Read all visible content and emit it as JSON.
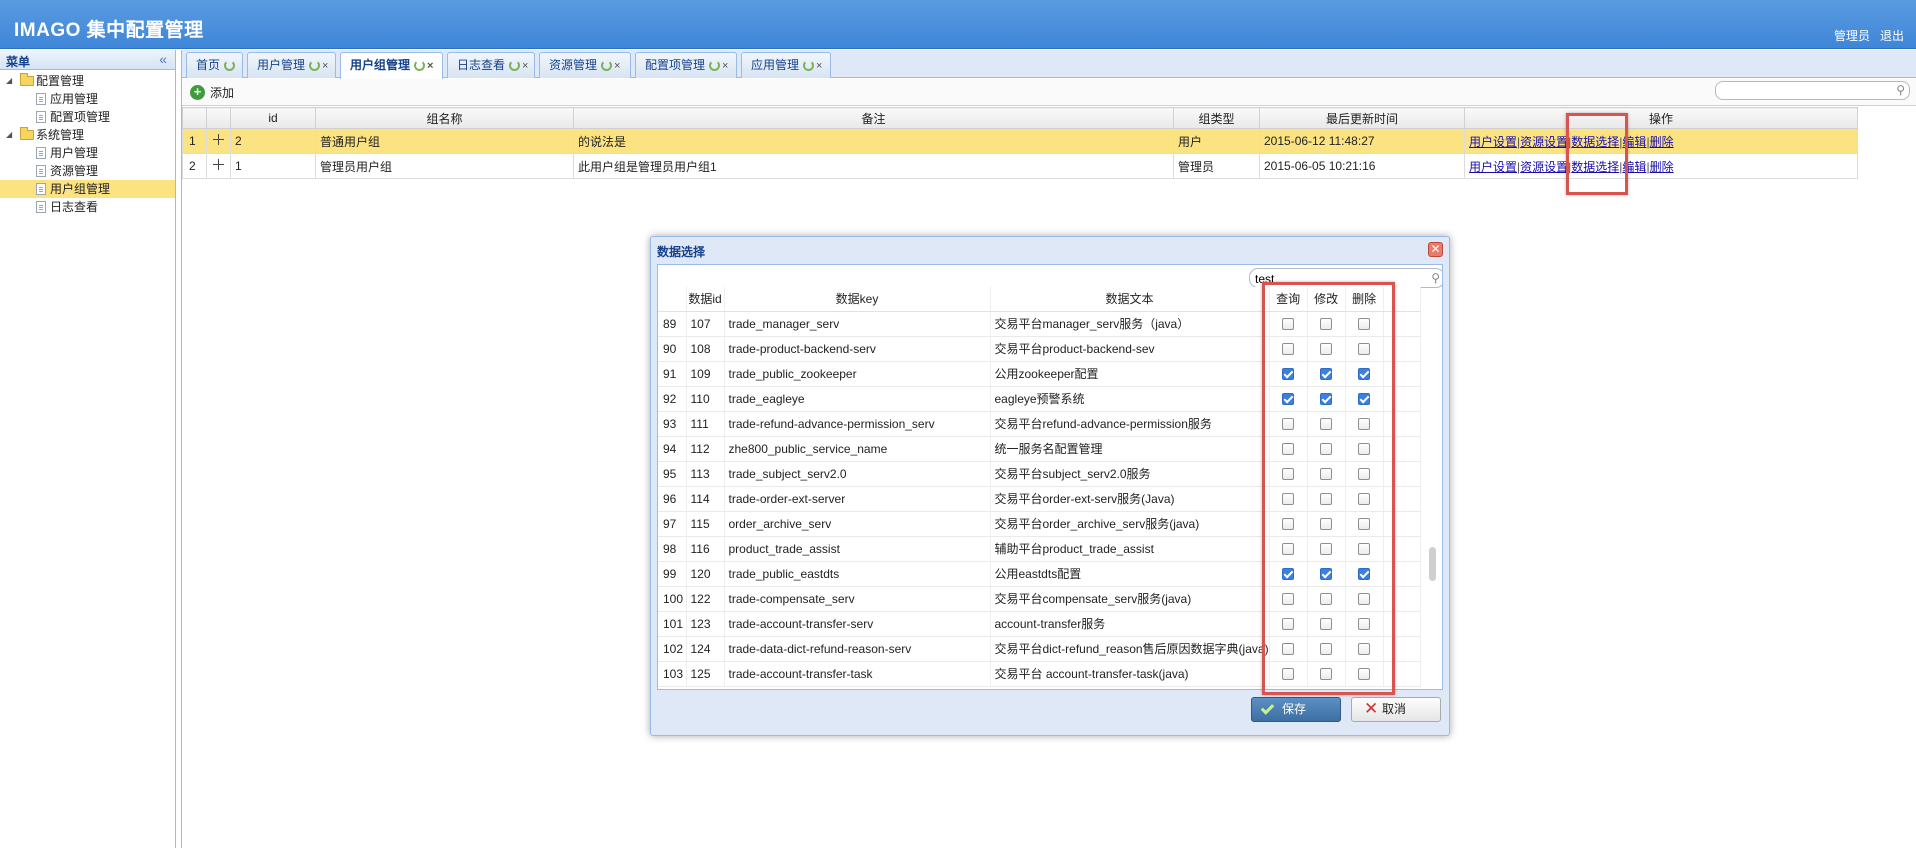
{
  "header": {
    "title": "IMAGO 集中配置管理",
    "user": "管理员",
    "logout": "退出"
  },
  "sidebar": {
    "title": "菜单",
    "collapse_glyph": "«",
    "groups": [
      {
        "label": "配置管理",
        "children": [
          "应用管理",
          "配置项管理"
        ]
      },
      {
        "label": "系统管理",
        "children": [
          "用户管理",
          "资源管理",
          "用户组管理",
          "日志查看"
        ]
      }
    ],
    "selected": "用户组管理"
  },
  "tabs": [
    {
      "label": "首页",
      "active": false,
      "closable": false
    },
    {
      "label": "用户管理",
      "active": false,
      "closable": true
    },
    {
      "label": "用户组管理",
      "active": true,
      "closable": true
    },
    {
      "label": "日志查看",
      "active": false,
      "closable": true
    },
    {
      "label": "资源管理",
      "active": false,
      "closable": true
    },
    {
      "label": "配置项管理",
      "active": false,
      "closable": true
    },
    {
      "label": "应用管理",
      "active": false,
      "closable": true
    }
  ],
  "toolbar": {
    "add_label": "添加",
    "search_placeholder": ""
  },
  "grid": {
    "columns": [
      "id",
      "组名称",
      "备注",
      "组类型",
      "最后更新时间",
      "操作"
    ],
    "rows": [
      {
        "n": "1",
        "id": "2",
        "name": "普通用户组",
        "remark": "的说法是",
        "type": "用户",
        "updated": "2015-06-12 11:48:27"
      },
      {
        "n": "2",
        "id": "1",
        "name": "管理员用户组",
        "remark": "此用户组是管理员用户组1",
        "type": "管理员",
        "updated": "2015-06-05 10:21:16"
      }
    ],
    "ops": [
      "用户设置",
      "资源设置",
      "数据选择",
      "编辑",
      "删除"
    ]
  },
  "dialog": {
    "title": "数据选择",
    "search_value": "test",
    "columns": [
      "数据id",
      "数据key",
      "数据文本",
      "查询",
      "修改",
      "删除"
    ],
    "rows": [
      {
        "n": "89",
        "id": "107",
        "key": "trade_manager_serv",
        "text": "交易平台manager_serv服务（java）",
        "q": false,
        "u": false,
        "d": false
      },
      {
        "n": "90",
        "id": "108",
        "key": "trade-product-backend-serv",
        "text": "交易平台product-backend-sev",
        "q": false,
        "u": false,
        "d": false
      },
      {
        "n": "91",
        "id": "109",
        "key": "trade_public_zookeeper",
        "text": "公用zookeeper配置",
        "q": true,
        "u": true,
        "d": true
      },
      {
        "n": "92",
        "id": "110",
        "key": "trade_eagleye",
        "text": "eagleye预警系统",
        "q": true,
        "u": true,
        "d": true
      },
      {
        "n": "93",
        "id": "111",
        "key": "trade-refund-advance-permission_serv",
        "text": "交易平台refund-advance-permission服务",
        "q": false,
        "u": false,
        "d": false
      },
      {
        "n": "94",
        "id": "112",
        "key": "zhe800_public_service_name",
        "text": "统一服务名配置管理",
        "q": false,
        "u": false,
        "d": false
      },
      {
        "n": "95",
        "id": "113",
        "key": "trade_subject_serv2.0",
        "text": "交易平台subject_serv2.0服务",
        "q": false,
        "u": false,
        "d": false
      },
      {
        "n": "96",
        "id": "114",
        "key": "trade-order-ext-server",
        "text": "交易平台order-ext-serv服务(Java)",
        "q": false,
        "u": false,
        "d": false
      },
      {
        "n": "97",
        "id": "115",
        "key": "order_archive_serv",
        "text": "交易平台order_archive_serv服务(java)",
        "q": false,
        "u": false,
        "d": false
      },
      {
        "n": "98",
        "id": "116",
        "key": "product_trade_assist",
        "text": "辅助平台product_trade_assist",
        "q": false,
        "u": false,
        "d": false
      },
      {
        "n": "99",
        "id": "120",
        "key": "trade_public_eastdts",
        "text": "公用eastdts配置",
        "q": true,
        "u": true,
        "d": true
      },
      {
        "n": "100",
        "id": "122",
        "key": "trade-compensate_serv",
        "text": "交易平台compensate_serv服务(java)",
        "q": false,
        "u": false,
        "d": false
      },
      {
        "n": "101",
        "id": "123",
        "key": "trade-account-transfer-serv",
        "text": "account-transfer服务",
        "q": false,
        "u": false,
        "d": false
      },
      {
        "n": "102",
        "id": "124",
        "key": "trade-data-dict-refund-reason-serv",
        "text": "交易平台dict-refund_reason售后原因数据字典(java)",
        "q": false,
        "u": false,
        "d": false
      },
      {
        "n": "103",
        "id": "125",
        "key": "trade-account-transfer-task",
        "text": "交易平台 account-transfer-task(java)",
        "q": false,
        "u": false,
        "d": false
      }
    ],
    "save_label": "保存",
    "cancel_label": "取消"
  }
}
